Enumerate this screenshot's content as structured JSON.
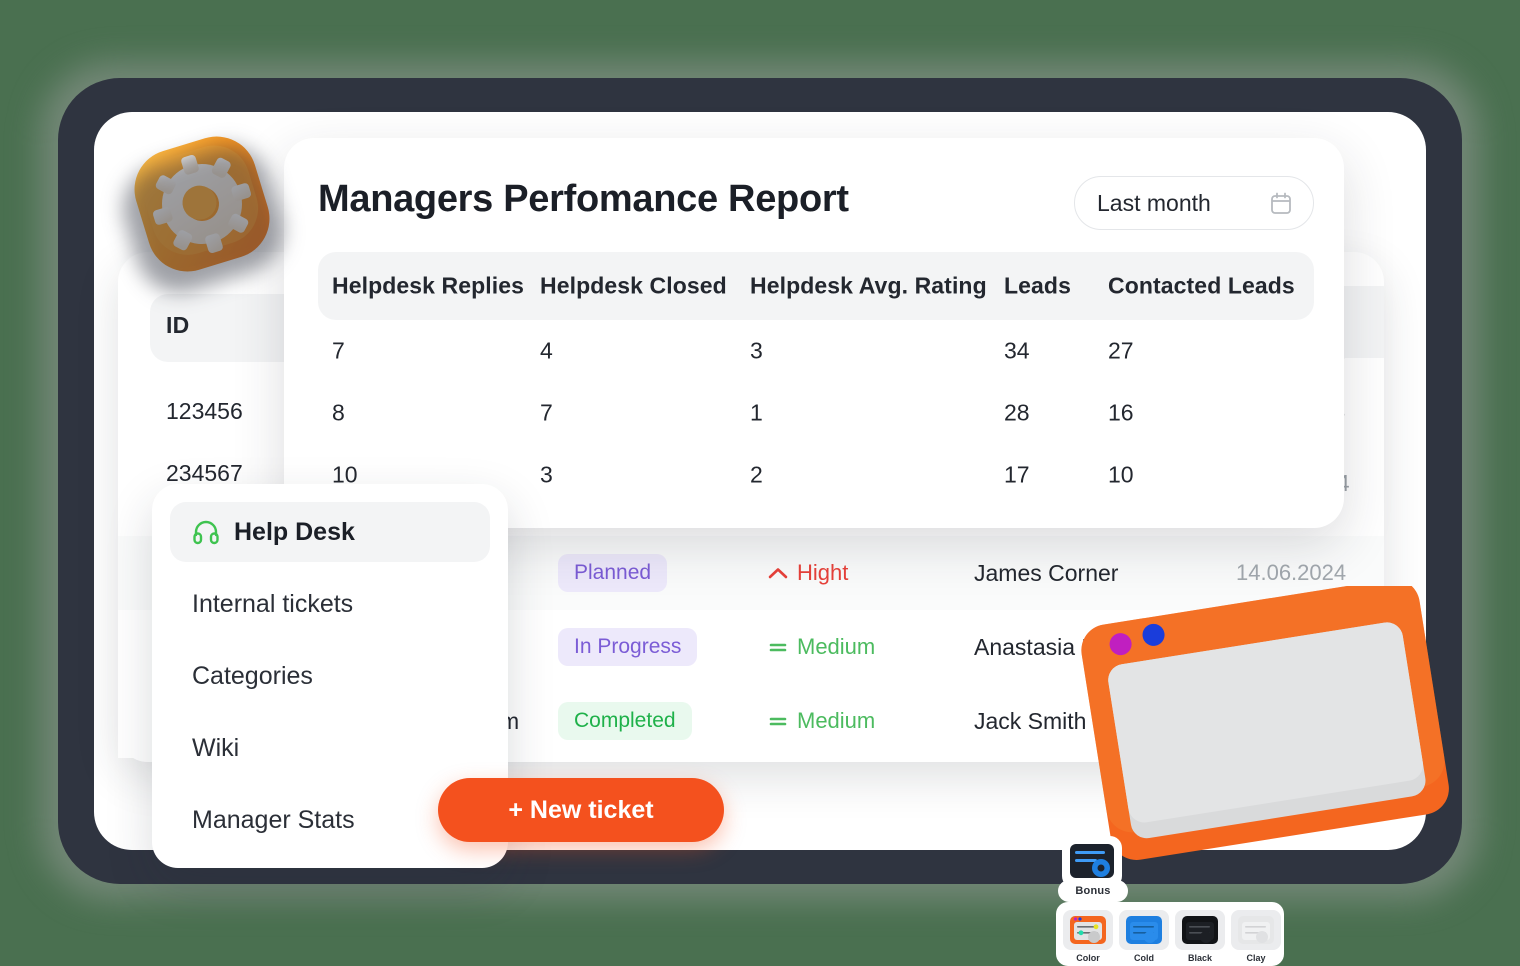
{
  "theme": {
    "page_background": "#4a7050",
    "device_frame": "#2f3440",
    "accent_orange": "#f4511e",
    "badge_purple_text": "#7b5cd6",
    "badge_purple_bg": "#ede9fb",
    "badge_green_text": "#1fb14a",
    "badge_green_bg": "#e9f9ee",
    "priority_high": "#e8413a",
    "priority_medium": "#4cbb5f",
    "muted_text": "#a2a8ae"
  },
  "report": {
    "title": "Managers Perfomance Report",
    "date_picker": {
      "label": "Last month",
      "icon": "calendar-icon"
    },
    "columns": [
      "Helpdesk Replies",
      "Helpdesk Closed",
      "Helpdesk Avg. Rating",
      "Leads",
      "Contacted Leads"
    ],
    "rows": [
      [
        "7",
        "4",
        "3",
        "34",
        "27"
      ],
      [
        "8",
        "7",
        "1",
        "28",
        "16"
      ],
      [
        "10",
        "3",
        "2",
        "17",
        "10"
      ]
    ]
  },
  "background_table": {
    "id_header": "ID",
    "ids": [
      "123456",
      "234567"
    ],
    "tail_values": [
      "4",
      "24"
    ]
  },
  "tickets": {
    "rows": [
      {
        "partial_text": "",
        "status": "Planned",
        "status_kind": "planned",
        "priority": "Hight",
        "priority_kind": "high",
        "priority_icon": "chevron-up-icon",
        "assignee": "James Corner",
        "date": "14.06.2024"
      },
      {
        "partial_text": "",
        "status": "In Progress",
        "status_kind": "inprogress",
        "priority": "Medium",
        "priority_kind": "medium",
        "priority_icon": "equals-icon",
        "assignee": "Anastasia Kolgan",
        "date": ""
      },
      {
        "partial_text": "m",
        "status": "Completed",
        "status_kind": "completed",
        "priority": "Medium",
        "priority_kind": "medium",
        "priority_icon": "equals-icon",
        "assignee": "Jack Smith",
        "date": ""
      }
    ]
  },
  "sidebar": {
    "items": [
      {
        "label": "Help Desk",
        "icon": "headphones-icon",
        "active": true
      },
      {
        "label": "Internal tickets",
        "icon": "",
        "active": false
      },
      {
        "label": "Categories",
        "icon": "",
        "active": false
      },
      {
        "label": "Wiki",
        "icon": "",
        "active": false
      },
      {
        "label": "Manager Stats",
        "icon": "",
        "active": false
      }
    ]
  },
  "actions": {
    "new_ticket_label": "+ New ticket"
  },
  "decorations": {
    "gear_badge_icon": "gear-3d-icon",
    "settings_window_icon": "settings-window-3d-icon",
    "bonus_label": "Bonus",
    "swatches": [
      {
        "name": "Color"
      },
      {
        "name": "Cold"
      },
      {
        "name": "Black"
      },
      {
        "name": "Clay"
      }
    ]
  }
}
